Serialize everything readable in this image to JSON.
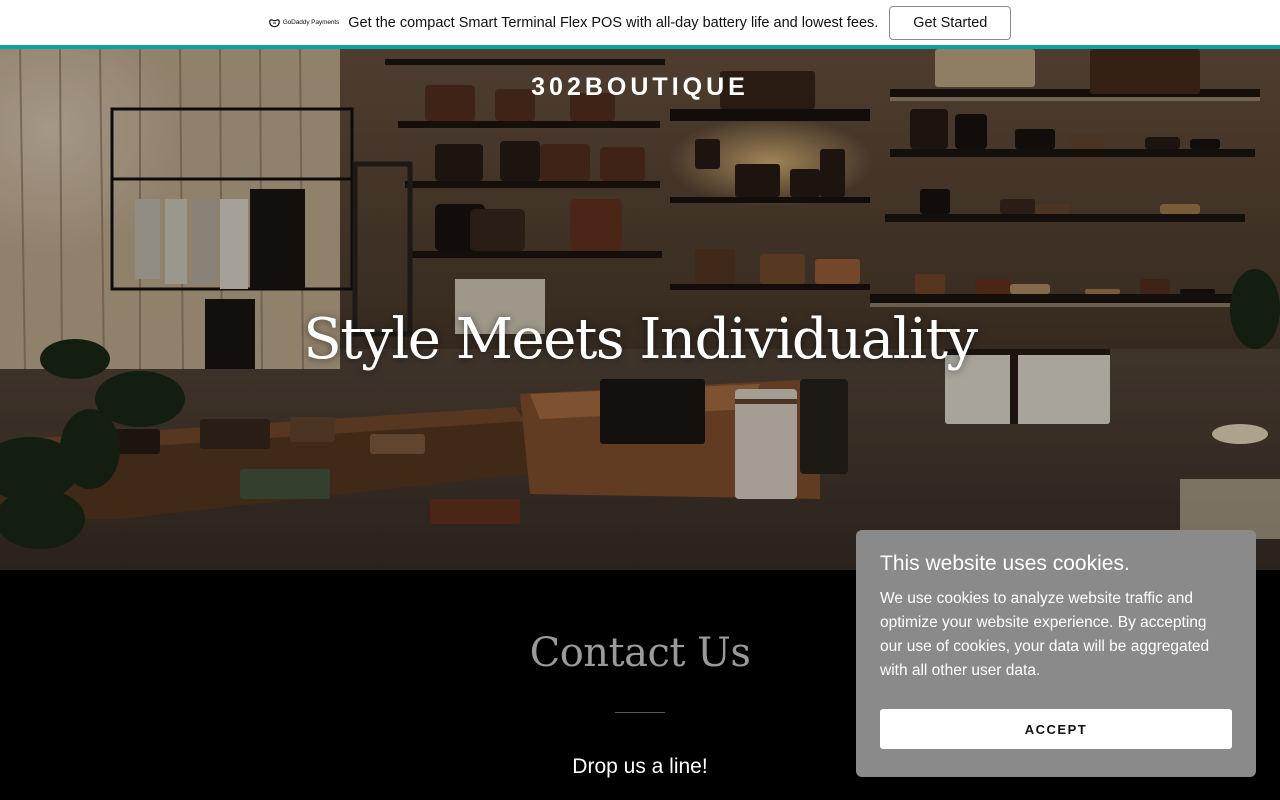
{
  "promo": {
    "logo_text": "GoDaddy Payments",
    "message": "Get the compact Smart Terminal Flex POS with all-day battery life and lowest fees.",
    "cta_label": "Get Started",
    "accent_color": "#0fa2a3"
  },
  "hero": {
    "brand": "302BOUTIQUE",
    "title": "Style Meets Individuality"
  },
  "contact": {
    "title": "Contact Us",
    "subtitle": "Drop us a line!"
  },
  "cookie_banner": {
    "title": "This website uses cookies.",
    "body": "We use cookies to analyze website traffic and optimize your website experience. By accepting our use of cookies, your data will be aggregated with all other user data.",
    "accept_label": "ACCEPT",
    "background_color": "#8a8a8a"
  }
}
